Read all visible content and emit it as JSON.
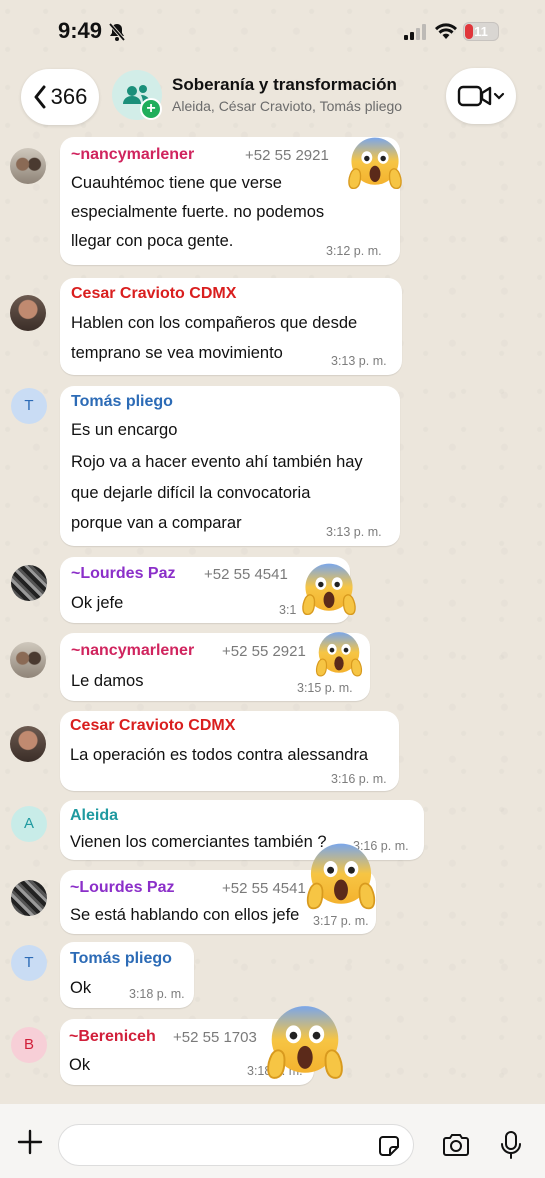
{
  "status_bar": {
    "time": "9:49",
    "battery": "11"
  },
  "header": {
    "back_count": "366",
    "title": "Soberanía y transformación",
    "subtitle": "Aleida, César Cravioto, Tomás pliego"
  },
  "messages": [
    {
      "sender": "~nancymarlener",
      "phone": "+52 55 2921",
      "lines": [
        "Cuauhtémoc tiene que verse",
        "especialmente fuerte. no podemos",
        "llegar con poca gente."
      ],
      "time": "3:12 p. m."
    },
    {
      "sender": "Cesar Cravioto CDMX",
      "phone": "",
      "lines": [
        "Hablen con los compañeros  que desde",
        "temprano se vea movimiento"
      ],
      "time": "3:13 p. m."
    },
    {
      "sender": "Tomás pliego",
      "phone": "",
      "avatar_letter": "T",
      "lines": [
        "Es un encargo",
        "Rojo va a hacer evento ahí también hay",
        "que dejarle difícil la convocatoria",
        "porque van a comparar"
      ],
      "time": "3:13 p. m."
    },
    {
      "sender": "~Lourdes Paz",
      "phone": "+52 55 4541",
      "lines": [
        "Ok jefe"
      ],
      "time": "3:1"
    },
    {
      "sender": "~nancymarlener",
      "phone": "+52 55 2921",
      "lines": [
        "Le damos"
      ],
      "time": "3:15 p. m."
    },
    {
      "sender": "Cesar Cravioto CDMX",
      "phone": "",
      "lines": [
        "La operación es todos contra alessandra"
      ],
      "time": "3:16 p. m."
    },
    {
      "sender": "Aleida",
      "phone": "",
      "avatar_letter": "A",
      "lines": [
        "Vienen los comerciantes también ?"
      ],
      "time": "3:16 p. m."
    },
    {
      "sender": "~Lourdes Paz",
      "phone": "+52 55 4541",
      "lines": [
        "Se está hablando con ellos jefe"
      ],
      "time": "3:17 p. m."
    },
    {
      "sender": "Tomás pliego",
      "phone": "",
      "avatar_letter": "T",
      "lines": [
        "Ok"
      ],
      "time": "3:18 p. m."
    },
    {
      "sender": "~Bereniceh",
      "phone": "+52 55 1703",
      "avatar_letter": "B",
      "lines": [
        "Ok"
      ],
      "time": "3:18 p. m."
    }
  ],
  "colors": {
    "nancy": "#d0245e",
    "cesar": "#d91e1e",
    "tomas": "#2c6bb6",
    "lourdes": "#8b2fc9",
    "aleida": "#1f9aa0",
    "bereniceh": "#d11f3a",
    "green_plus": "#1fae5b"
  },
  "icons": [
    "bell-off-icon",
    "signal-icon",
    "wifi-icon",
    "battery-icon",
    "chevron-left-icon",
    "group-icon",
    "video-call-icon",
    "plus-icon",
    "sticker-icon",
    "camera-icon",
    "mic-icon",
    "screaming-emoji"
  ]
}
